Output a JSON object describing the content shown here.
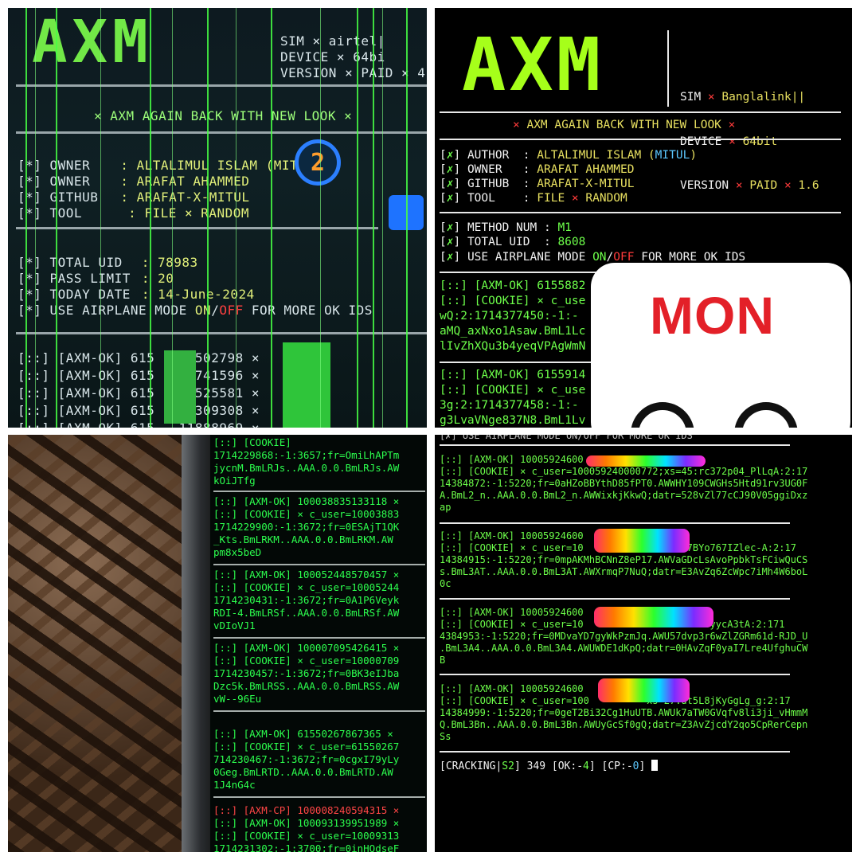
{
  "panel1": {
    "logo": "AXM",
    "info": [
      "SIM × airtel|",
      "DEVICE × 64bi",
      "VERSION × PAID × 4"
    ],
    "banner": "× AXM AGAIN BACK WITH NEW LOOK ×",
    "fields": [
      {
        "key": "[*] OWNER",
        "val": ": ALTALIMUL ISLAM (MITUL)"
      },
      {
        "key": "[*] OWNER",
        "val": ": ARAFAT AHAMMED"
      },
      {
        "key": "[*] GITHUB",
        "val": ": ARAFAT-X-MITUL"
      },
      {
        "key": "[*] TOOL",
        "val": ": FILE × RANDOM"
      }
    ],
    "stats": [
      {
        "key": "[*] TOTAL UID",
        "val": ": 78983"
      },
      {
        "key": "[*] PASS LIMIT",
        "val": ": 20"
      },
      {
        "key": "[*] TODAY DATE",
        "val": ": 14-June-2024"
      }
    ],
    "airplane": {
      "pre": "[*] USE AIRPLANE MODE ",
      "on": "ON",
      "sep": "/",
      "off": "OFF",
      "post": " FOR MORE OK IDS"
    },
    "badge": "2",
    "results": [
      "[::] [AXM-OK] 615   35502798 ×",
      "[::] [AXM-OK] 615   70741596 ×",
      "[::] [AXM-OK] 615   13525581 ×",
      "[::] [AXM-OK] 615   12309308 ×",
      "[::] [AXM-OK] 615   11888969 ×"
    ]
  },
  "panel2": {
    "logo": "AXM",
    "info": {
      "sim": {
        "k": "SIM",
        "v": "Banglalink||"
      },
      "device": {
        "k": "DEVICE",
        "v": "64bit"
      },
      "version": {
        "k": "VERSION",
        "v": "PAID",
        "v2": "1.6"
      }
    },
    "banner": "AXM AGAIN BACK WITH NEW LOOK",
    "fields": [
      {
        "k": "AUTHOR ",
        "v": "ALTALIMUL ISLAM (",
        "v2": "MITUL",
        "v3": ")"
      },
      {
        "k": "OWNER  ",
        "v": "ARAFAT AHAMMED"
      },
      {
        "k": "GITHUB ",
        "v": "ARAFAT-X-MITUL"
      },
      {
        "k": "TOOL   ",
        "v": "FILE",
        "v2": "RANDOM"
      }
    ],
    "method": {
      "k": "METHOD NUM ",
      "v": "M1"
    },
    "total": {
      "k": "TOTAL UID  ",
      "v": "8608"
    },
    "airplane": {
      "pre": "USE AIRPLANE MODE ",
      "on": "ON",
      "off": "OFF",
      "post": " FOR MORE OK IDS"
    },
    "ok1": "[::] [AXM-OK] 6155882",
    "cookie1": "[::] [COOKIE] × c_use",
    "cookie1b": "wQ:2:1714377450:-1:-",
    "cookie1c": "aMQ_axNxo1Asaw.BmL1Lc",
    "cookie1d": "lIvZhXQu3b4yeqVPAgWmN",
    "ok2": "[::] [AXM-OK] 6155914",
    "cookie2": "[::] [COOKIE] × c_use",
    "cookie2b": "3g:2:1714377458:-1:-",
    "cookie2c": "g3LvaVNge837N8.BmL1Lv",
    "card": "MON"
  },
  "panel3": {
    "lines": [
      "[::] [COOKIE]",
      "1714229868:-1:3657;fr=OmiLhAPTm",
      "jycnM.BmLRJs..AAA.0.0.BmLRJs.AW",
      "kOiJTfg",
      "[::] [AXM-OK] 100038835133118 ×",
      "[::] [COOKIE] × c_user=10003883",
      "1714229900:-1:3672;fr=0ESAjT1QK",
      "_Kts.BmLRKM..AAA.0.0.BmLRKM.AW",
      "pm8x5beD",
      "[::] [AXM-OK] 100052448570457 ×",
      "[::] [COOKIE] × c_user=10005244",
      "1714230431:-1:3672;fr=0A1P6Veyk",
      "RDI-4.BmLRSf..AAA.0.0.BmLRSf.AW",
      "vDIoVJ1",
      "[::] [AXM-OK] 100007095426415 ×",
      "[::] [COOKIE] × c_user=10000709",
      "1714230457:-1:3672;fr=0BK3eIJba",
      "Dzc5k.BmLRSS..AAA.0.0.BmLRSS.AW",
      "vW--96Eu",
      "[::] [AXM-OK] 61550267867365 ×",
      "[::] [COOKIE] × c_user=61550267",
      "714230467:-1:3672;fr=0cgxI79yLy",
      "0Geg.BmLRTD..AAA.0.0.BmLRTD.AW",
      "1J4nG4c",
      "[::] [AXM-CP] 100008240594315 ×",
      "[::] [AXM-OK] 100093139951989 ×",
      "[::] [COOKIE] × c_user=10009313",
      "1714231302:-1:3700;fr=0inHQdseF"
    ]
  },
  "panel4": {
    "top": "[✗] USE AIRPLANE MODE ON/OFF FOR MORE OK IDS",
    "blocks": [
      {
        "ok": "[::] [AXM-OK] 10005924600",
        "cookie": "[::] [COOKIE] × c_user=100059240000772;xs=45:rc372p04_PlLqA:2:17",
        "l2": "14384872:-1:5220;fr=0aHZoBBYthD85fPT0.AWWHY109CWGHs5Htd91rv3UG0F",
        "l3": "A.BmL2_n..AAA.0.0.BmL2_n.AWWixkjKkwQ;datr=528vZl77cCJ90V05ggiDxz",
        "l4": "ap"
      },
      {
        "ok": "[::] [AXM-OK] 10005924600",
        "cookie": "[::] [COOKIE] × c_user=10          2;xs=24:7BYo767IZlec-A:2:17",
        "l2": "14384915:-1:5220;fr=0mpAKMhBCNnZ8eP17.AWVaGDcLsAvoPpbkTsFCiwQuCS",
        "l3": "s.BmL3AT..AAA.0.0.BmL3AT.AWXrmqP7NuQ;datr=E3AvZq6ZcWpc7iMh4W6boL",
        "l4": "0c"
      },
      {
        "ok": "[::] [AXM-OK] 10005924600",
        "cookie": "[::] [COOKIE] × c_user=10           s=7:oorVIb3yycA3tA:2:171",
        "l2": "4384953:-1:5220;fr=0MDvaYD7gyWkPzmJq.AWU57dvp3r6wZlZGRm61d-RJD_U",
        "l3": ".BmL3A4..AAA.0.0.BmL3A4.AWUWDE1dKpQ;datr=0HAvZqF0yaI7Lre4UfghuCW",
        "l4": "B"
      },
      {
        "ok": "[::] [AXM-OK] 10005924600",
        "cookie": "[::] [COOKIE] × c_user=100          xs=27:ut5L8jKyGgLg_g:2:17",
        "l2": "14384999:-1:5220;fr=0geT2Bi32Cg1HuUTB.AWUk7aTW0GVqfv8li3ji_vHmmM",
        "l3": "Q.BmL3Bn..AAA.0.0.BmL3Bn.AWUyGcSf0gQ;datr=Z3AvZjcdY2qo5CpRerCepn",
        "l4": "Ss"
      }
    ],
    "status": {
      "a": "[CRACKING",
      "b": "S2",
      "c": "349",
      "ok": "4",
      "cp": "0"
    }
  }
}
